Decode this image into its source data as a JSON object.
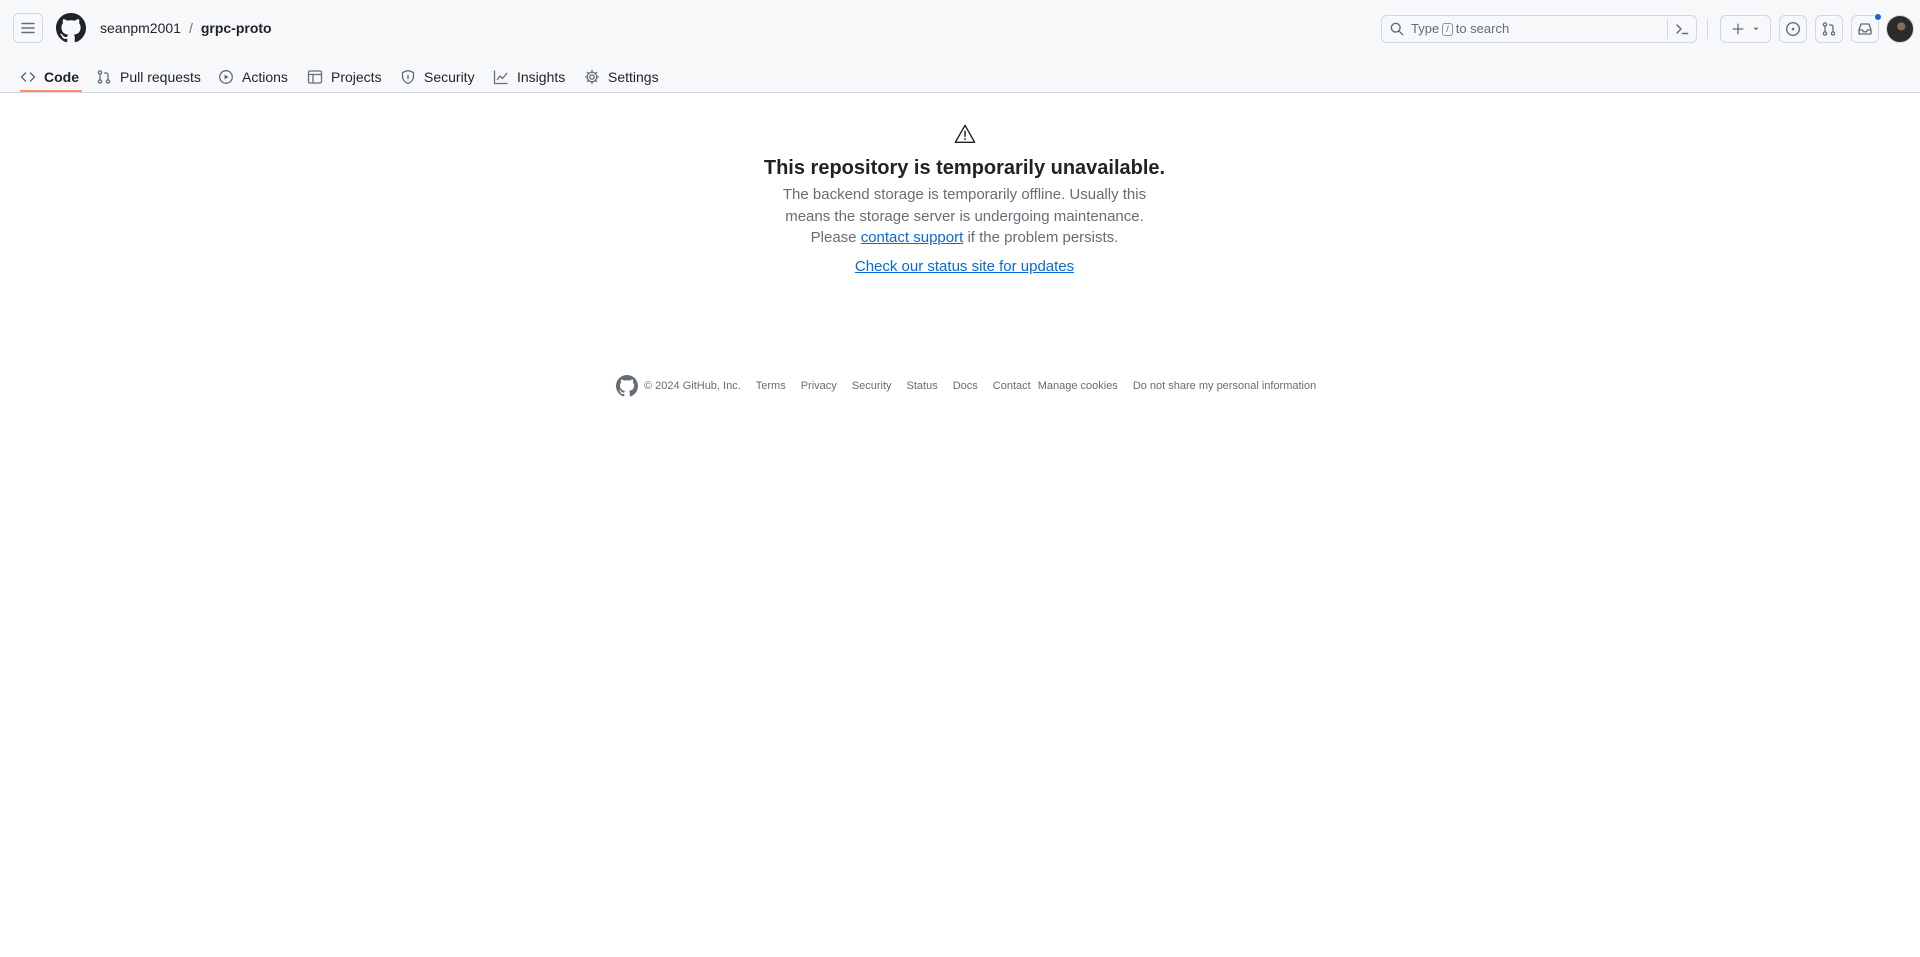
{
  "header": {
    "breadcrumb": {
      "owner": "seanpm2001",
      "separator": "/",
      "repo": "grpc-proto"
    },
    "search": {
      "prefix": "Type",
      "key": "/",
      "suffix": "to search"
    }
  },
  "nav": {
    "tabs": [
      {
        "label": "Code",
        "icon": "code-icon",
        "active": true
      },
      {
        "label": "Pull requests",
        "icon": "git-pull-request-icon"
      },
      {
        "label": "Actions",
        "icon": "play-icon"
      },
      {
        "label": "Projects",
        "icon": "table-icon"
      },
      {
        "label": "Security",
        "icon": "shield-icon"
      },
      {
        "label": "Insights",
        "icon": "graph-icon"
      },
      {
        "label": "Settings",
        "icon": "gear-icon"
      }
    ]
  },
  "main": {
    "title": "This repository is temporarily unavailable.",
    "desc_line1": "The backend storage is temporarily offline. Usually this",
    "desc_line2": "means the storage server is undergoing maintenance.",
    "desc_prefix": "Please",
    "contact_link": "contact support",
    "desc_suffix": "if the problem persists.",
    "status_link": "Check our status site for updates"
  },
  "footer": {
    "copyright": "© 2024 GitHub, Inc.",
    "links": [
      "Terms",
      "Privacy",
      "Security",
      "Status",
      "Docs",
      "Contact",
      "Manage cookies",
      "Do not share my personal information"
    ]
  },
  "colors": {
    "accent": "#0969da",
    "tab_underline": "#fd8c73",
    "header_bg": "#f6f8fa"
  }
}
